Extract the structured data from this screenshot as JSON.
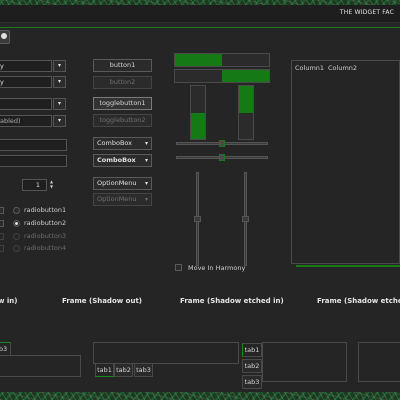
{
  "window": {
    "title": "THE WIDGET FAC"
  },
  "left_fields": {
    "combo_entry_1": "y",
    "combo_entry_2": "y",
    "combo_entry_3": "",
    "combo_entry_4": "abled)",
    "entry_1": "",
    "entry_2": ""
  },
  "spin": {
    "value": "1"
  },
  "checkboxes": [
    "",
    "",
    "",
    ""
  ],
  "radios": [
    "radiobutton1",
    "radiobutton2",
    "radiobutton3",
    "radiobutton4"
  ],
  "buttons": {
    "button1": "button1",
    "button2": "button2",
    "toggle1": "togglebutton1",
    "toggle2": "togglebutton2"
  },
  "combos": {
    "combo1": "ComboBox",
    "combo2": "ComboBox",
    "option1": "OptionMenu",
    "option2": "OptionMenu"
  },
  "progress": {
    "h1": 0.5,
    "h2": 0.5,
    "v1": 0.5,
    "v2": 0.5
  },
  "scales": {
    "h1": 0.5,
    "h2": 0.5,
    "v1": 0.5,
    "v2": 0.5
  },
  "move_in_harmony": "Move In Harmony",
  "tree": {
    "columns": [
      "Column1",
      "Column2"
    ]
  },
  "frames": {
    "f1": "w in)",
    "f2": "Frame (Shadow out)",
    "f3": "Frame (Shadow etched in)",
    "f4": "Frame (Shadow etched ou"
  },
  "notebooks": {
    "nb1_tab": "b3",
    "nb2_tabs": [
      "tab1",
      "tab2",
      "tab3"
    ],
    "nb3_tabs": [
      "tab1",
      "tab2",
      "tab3"
    ]
  },
  "colors": {
    "accent": "#157a15",
    "background": "#252525"
  }
}
